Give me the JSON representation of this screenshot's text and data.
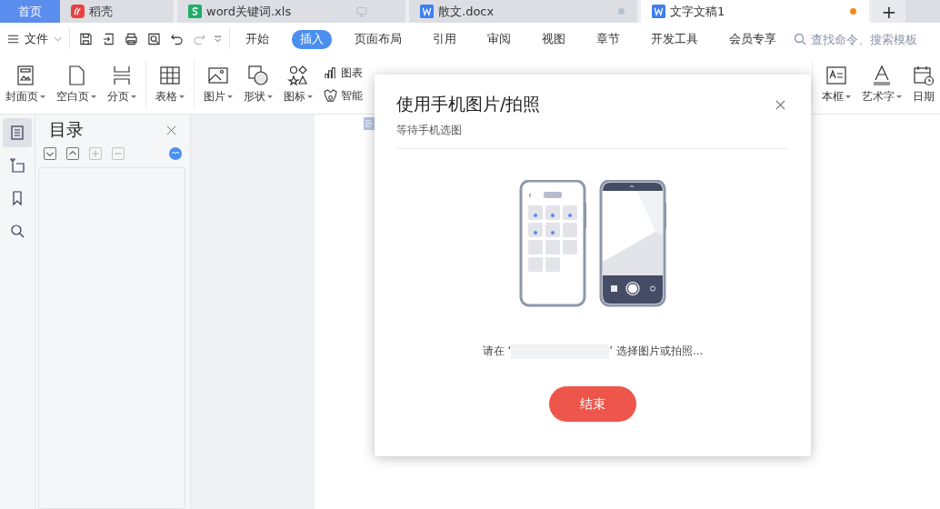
{
  "tabs": [
    {
      "label": "首页",
      "kind": "home",
      "selected": false
    },
    {
      "label": "稻壳",
      "kind": "docer",
      "selected": false
    },
    {
      "label": "word关键词.xls",
      "kind": "sheet",
      "selected": false
    },
    {
      "label": "散文.docx",
      "kind": "doc",
      "selected": false,
      "modified": false
    },
    {
      "label": "文字文稿1",
      "kind": "doc",
      "selected": true,
      "modified": true
    }
  ],
  "new_tab": "+",
  "menu": {
    "file": "文件",
    "items": [
      {
        "label": "开始",
        "selected": false
      },
      {
        "label": "插入",
        "selected": true
      },
      {
        "label": "页面布局",
        "selected": false
      },
      {
        "label": "引用",
        "selected": false
      },
      {
        "label": "审阅",
        "selected": false
      },
      {
        "label": "视图",
        "selected": false
      },
      {
        "label": "章节",
        "selected": false
      },
      {
        "label": "开发工具",
        "selected": false
      },
      {
        "label": "会员专享",
        "selected": false
      }
    ],
    "search": {
      "placeholder": "查找命令、搜索模板"
    }
  },
  "ribbon_left": [
    {
      "label": "封面页",
      "kind": "big"
    },
    {
      "label": "空白页",
      "kind": "big"
    },
    {
      "label": "分页",
      "kind": "big"
    },
    {
      "kind": "divider"
    },
    {
      "label": "表格",
      "kind": "big"
    },
    {
      "kind": "divider"
    },
    {
      "label": "图片",
      "kind": "big"
    },
    {
      "label": "形状",
      "kind": "big"
    },
    {
      "label": "图标",
      "kind": "big"
    },
    {
      "kind": "small",
      "items": [
        {
          "label": "图表"
        },
        {
          "label": "智能"
        }
      ]
    }
  ],
  "ribbon_right": [
    {
      "label": "本框"
    },
    {
      "label": "艺术字"
    },
    {
      "label": "日期"
    }
  ],
  "outline": {
    "title": "目录",
    "tools": [
      {
        "kind": "down",
        "disabled": false
      },
      {
        "kind": "up",
        "disabled": false
      },
      {
        "kind": "plus",
        "disabled": true
      },
      {
        "kind": "minus",
        "disabled": true
      }
    ]
  },
  "rail": [
    {
      "kind": "outline",
      "selected": true
    },
    {
      "kind": "nav",
      "selected": false
    },
    {
      "kind": "bookmark",
      "selected": false
    },
    {
      "kind": "search",
      "selected": false
    }
  ],
  "dialog": {
    "title": "使用手机图片/拍照",
    "subtitle": "等待手机选图",
    "message_before": "请在 ‘",
    "message_after": "’ 选择图片或拍照...",
    "end_button": "结束"
  }
}
